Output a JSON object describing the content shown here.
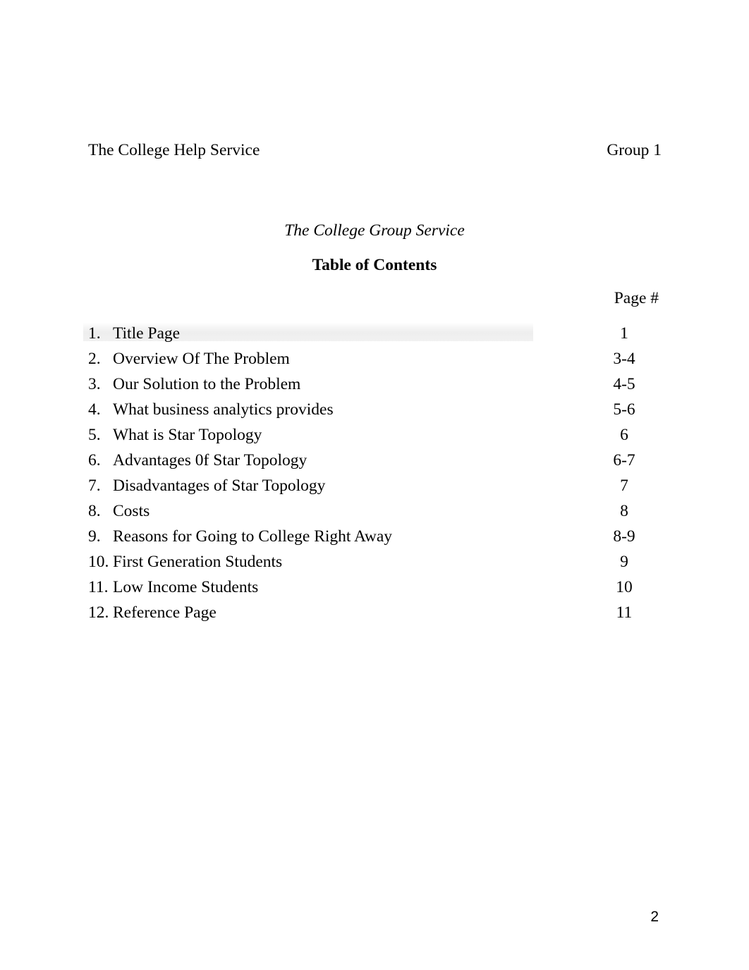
{
  "header": {
    "left": "The College Help Service",
    "right": "Group 1"
  },
  "title": "The College Group Service",
  "subtitle": "Table of Contents",
  "page_column_label": "Page #",
  "toc": {
    "items": [
      {
        "number": "1.",
        "label": "Title Page",
        "page": "1"
      },
      {
        "number": "2.",
        "label": "Overview Of The Problem",
        "page": "3-4"
      },
      {
        "number": "3.",
        "label": "Our Solution to the Problem",
        "page": "4-5"
      },
      {
        "number": "4.",
        "label": "What business analytics provides",
        "page": "5-6"
      },
      {
        "number": "5.",
        "label": "What is Star Topology",
        "page": "6"
      },
      {
        "number": "6.",
        "label": "Advantages 0f Star Topology",
        "page": "6-7"
      },
      {
        "number": "7.",
        "label": "Disadvantages of Star Topology",
        "page": "7"
      },
      {
        "number": "8.",
        "label": "Costs",
        "page": "8"
      },
      {
        "number": "9.",
        "label": "Reasons for Going to College Right Away",
        "page": "8-9"
      },
      {
        "number": "10.",
        "label": "First Generation Students",
        "page": "9"
      },
      {
        "number": "11.",
        "label": "Low Income Students",
        "page": "10"
      },
      {
        "number": "12.",
        "label": "Reference Page",
        "page": "11"
      }
    ]
  },
  "footer": {
    "page_number": "2"
  },
  "colors": {
    "text": "#000000",
    "background": "#ffffff",
    "smudge": "#ededed"
  }
}
